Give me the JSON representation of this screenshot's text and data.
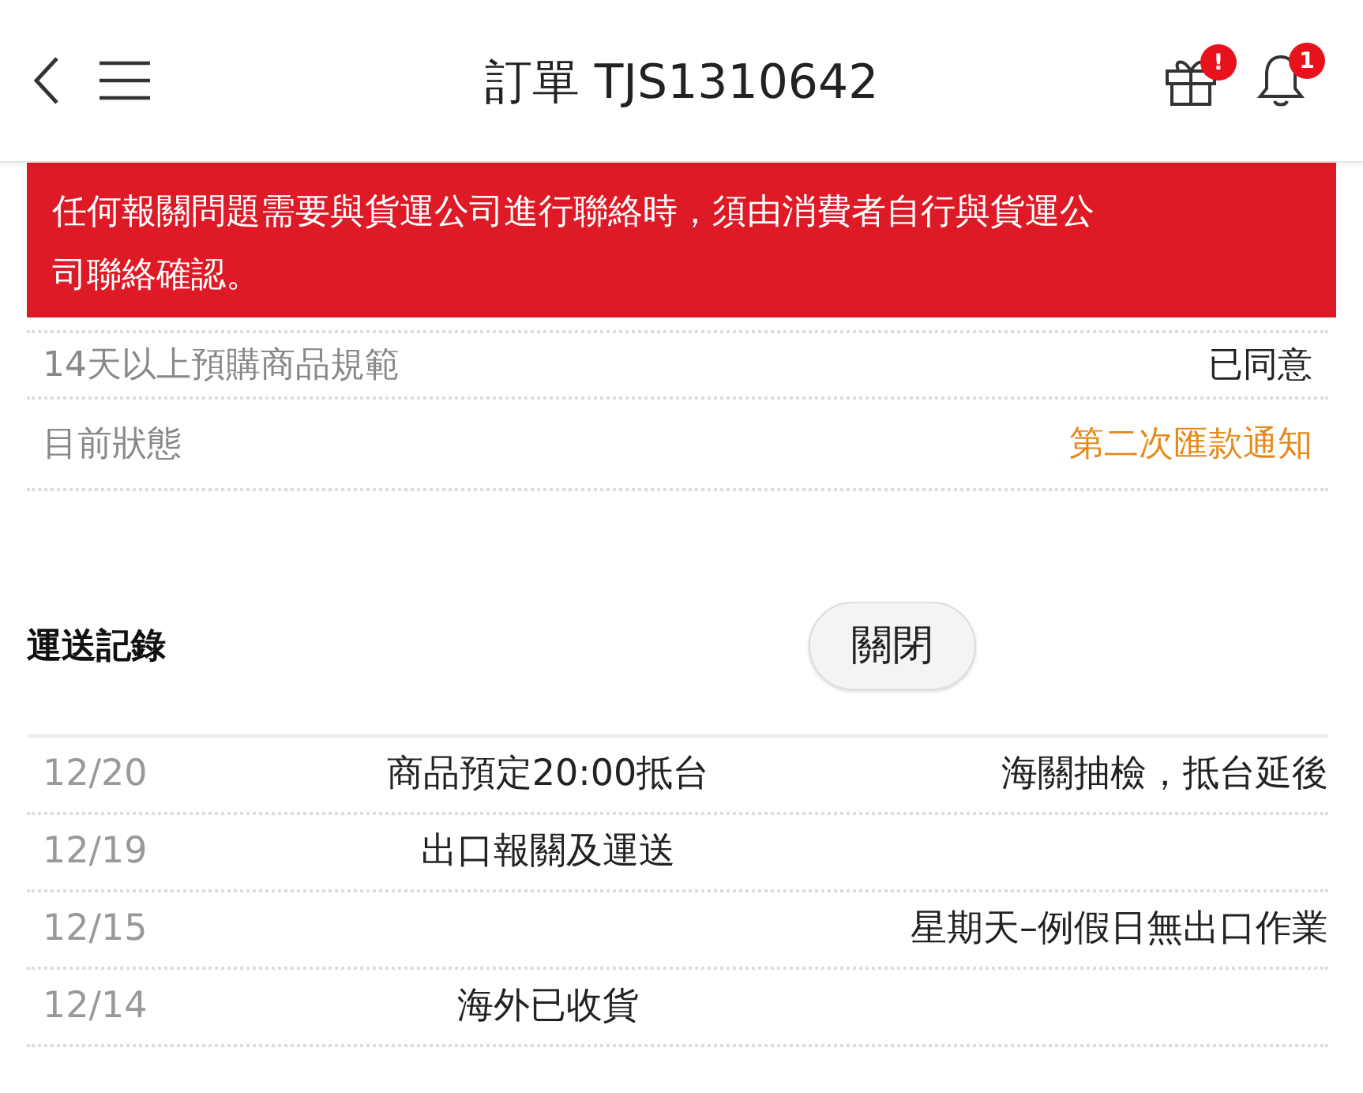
{
  "header": {
    "title": "訂單 TJS1310642",
    "gift_badge": "!",
    "bell_badge": "1"
  },
  "notice": {
    "lines": [
      "任何報關問題需要與貨運公司進行聯絡時，須由消費者自行與貨運公",
      "司聯絡確認。"
    ]
  },
  "details": [
    {
      "label": "14天以上預購商品規範",
      "value": "已同意",
      "kind": "plain"
    },
    {
      "label": "目前狀態",
      "value": "第二次匯款通知",
      "kind": "status"
    }
  ],
  "shipping": {
    "title": "運送記錄",
    "toggle_button": "關閉",
    "rows": [
      {
        "date": "12/20",
        "event": "商品預定20:00抵台",
        "note": "海關抽檢，抵台延後"
      },
      {
        "date": "12/19",
        "event": "出口報關及運送",
        "note": ""
      },
      {
        "date": "12/15",
        "event": "",
        "note": "星期天–例假日無出口作業"
      },
      {
        "date": "12/14",
        "event": "海外已收貨",
        "note": ""
      }
    ]
  }
}
